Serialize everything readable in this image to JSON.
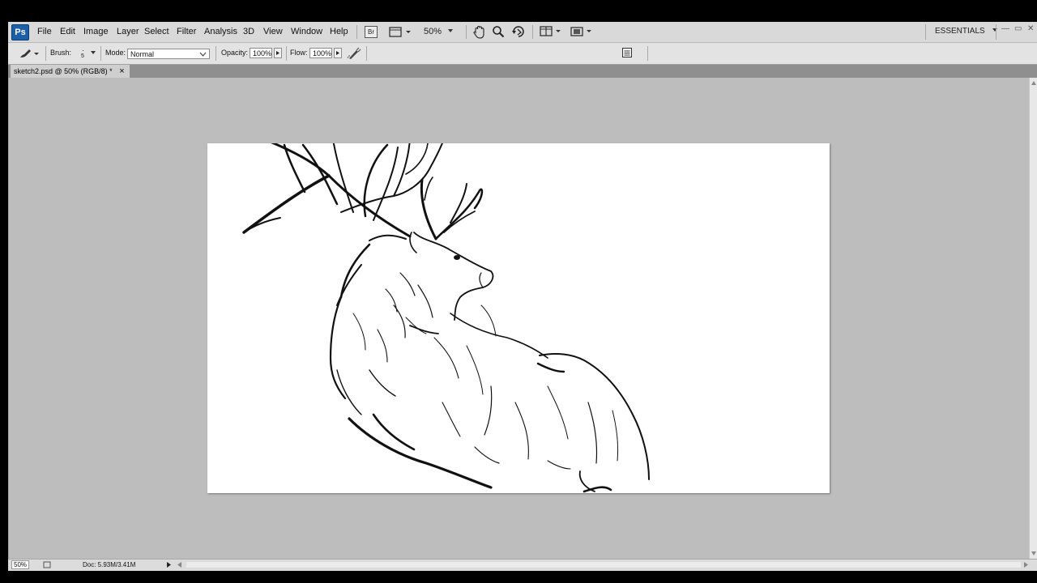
{
  "app": {
    "logo_text": "Ps",
    "workspace_label": "ESSENTIALS"
  },
  "menu": [
    "File",
    "Edit",
    "Image",
    "Layer",
    "Select",
    "Filter",
    "Analysis",
    "3D",
    "View",
    "Window",
    "Help"
  ],
  "appbar": {
    "bridge_label": "Br",
    "zoom_value": "50%"
  },
  "window_controls": {
    "minimize": "—",
    "restore": "▭",
    "close": "✕"
  },
  "options": {
    "brush_label": "Brush:",
    "brush_size": "5",
    "mode_label": "Mode:",
    "mode_value": "Normal",
    "opacity_label": "Opacity:",
    "opacity_value": "100%",
    "flow_label": "Flow:",
    "flow_value": "100%"
  },
  "document": {
    "tab_title": "sketch2.psd @ 50% (RGB/8) *",
    "tab_close": "×"
  },
  "status": {
    "zoom": "50%",
    "doc_info": "Doc: 5.93M/3.41M"
  },
  "icons": {
    "brush_tool": "brush-icon",
    "hand": "hand-icon",
    "zoom": "magnifier-icon",
    "rotate": "rotate-view-icon",
    "arrange": "arrange-documents-icon",
    "screen_mode": "screen-mode-icon",
    "airbrush": "airbrush-icon",
    "panel_toggle": "brush-panel-icon"
  }
}
